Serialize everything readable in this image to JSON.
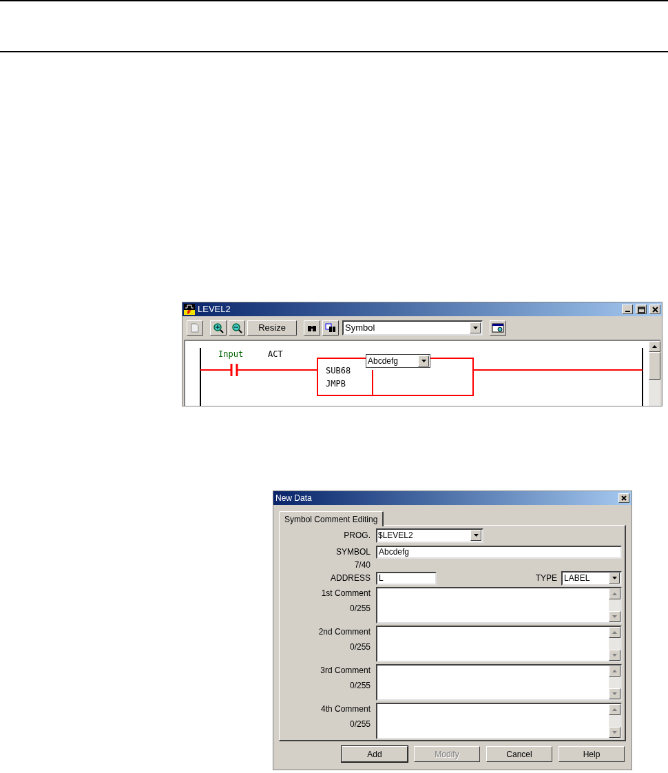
{
  "editor_window": {
    "title": "LEVEL2",
    "toolbar": {
      "resize_button": "Resize",
      "view_select": "Symbol"
    },
    "diagram": {
      "contact_label": "Input",
      "contact_address": "ACT",
      "function_lines": [
        "SUB68",
        "JMPB"
      ],
      "symbol_select": "Abcdefg"
    }
  },
  "dialog": {
    "title": "New Data",
    "tabs": [
      {
        "label": "Symbol Comment Editing",
        "selected": true
      }
    ],
    "prog": {
      "label": "PROG.",
      "value": "$LEVEL2"
    },
    "symbol": {
      "label": "SYMBOL",
      "value": "Abcdefg",
      "count": "7/40"
    },
    "address": {
      "label": "ADDRESS",
      "value": "L"
    },
    "type": {
      "label": "TYPE",
      "value": "LABEL"
    },
    "comments": [
      {
        "label": "1st Comment",
        "count": "0/255"
      },
      {
        "label": "2nd Comment",
        "count": "0/255"
      },
      {
        "label": "3rd Comment",
        "count": "0/255"
      },
      {
        "label": "4th Comment",
        "count": "0/255"
      }
    ],
    "buttons": [
      {
        "label": "Add",
        "disabled": false,
        "default": true
      },
      {
        "label": "Modify",
        "disabled": true,
        "default": false
      },
      {
        "label": "Cancel",
        "disabled": false,
        "default": false
      },
      {
        "label": "Help",
        "disabled": false,
        "default": false
      }
    ]
  }
}
